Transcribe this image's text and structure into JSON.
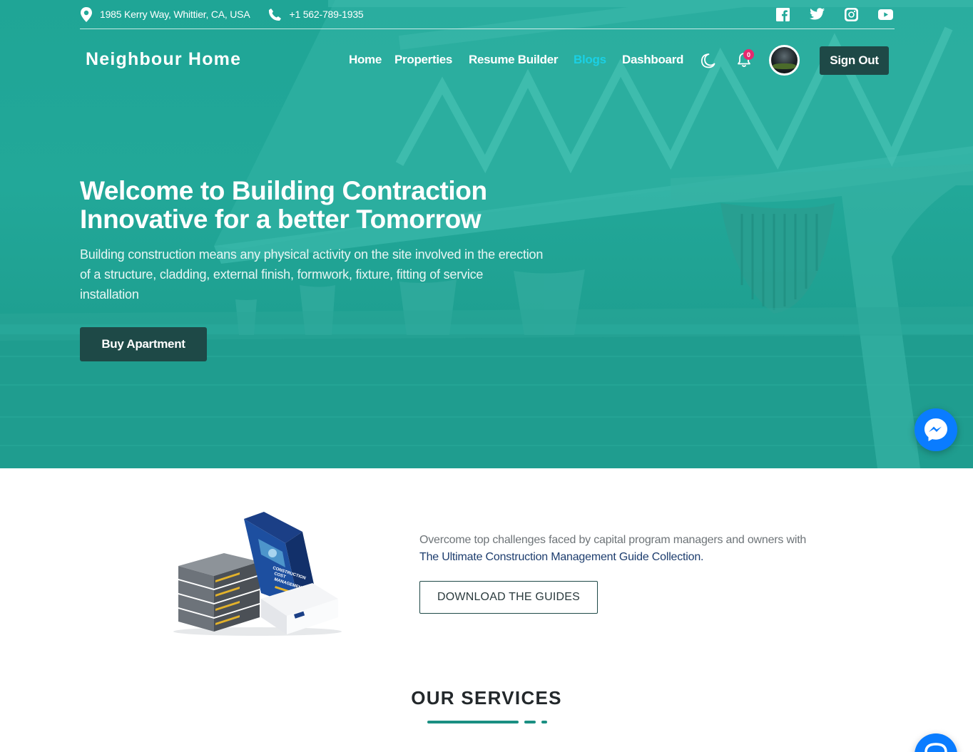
{
  "topbar": {
    "address": "1985 Kerry Way, Whittier, CA, USA",
    "phone": "+1 562-789-1935",
    "socials": [
      "facebook-icon",
      "twitter-icon",
      "instagram-icon",
      "youtube-icon"
    ]
  },
  "nav": {
    "brand": "Neighbour Home",
    "items": [
      "Home",
      "Properties",
      "Resume Builder",
      "Blogs",
      "Dashboard"
    ],
    "active": "Blogs",
    "notifications": "0",
    "sign_out": "Sign Out"
  },
  "hero": {
    "title_line1": "Welcome to Building Contraction",
    "title_line2": "Innovative for a better Tomorrow",
    "description": "Building construction means any physical activity on the site involved in the erection of a structure, cladding, external finish, formwork, fixture, fitting of service installation",
    "cta": "Buy Apartment"
  },
  "guide": {
    "text": "Overcome top challenges faced by capital program managers and owners with",
    "highlight": "The Ultimate Construction Management Guide Collection.",
    "button": "DOWNLOAD THE GUIDES",
    "book_cover_text": "CONSTRUCTION COST MANAGEMENT"
  },
  "services": {
    "title": "OUR SERVICES"
  },
  "colors": {
    "hero_overlay": "#22a899",
    "dark_button": "#1e4947",
    "active_link": "#1ad0e5",
    "badge": "#e6296f",
    "messenger": "#0a7cff",
    "accent": "#1a8f82"
  }
}
